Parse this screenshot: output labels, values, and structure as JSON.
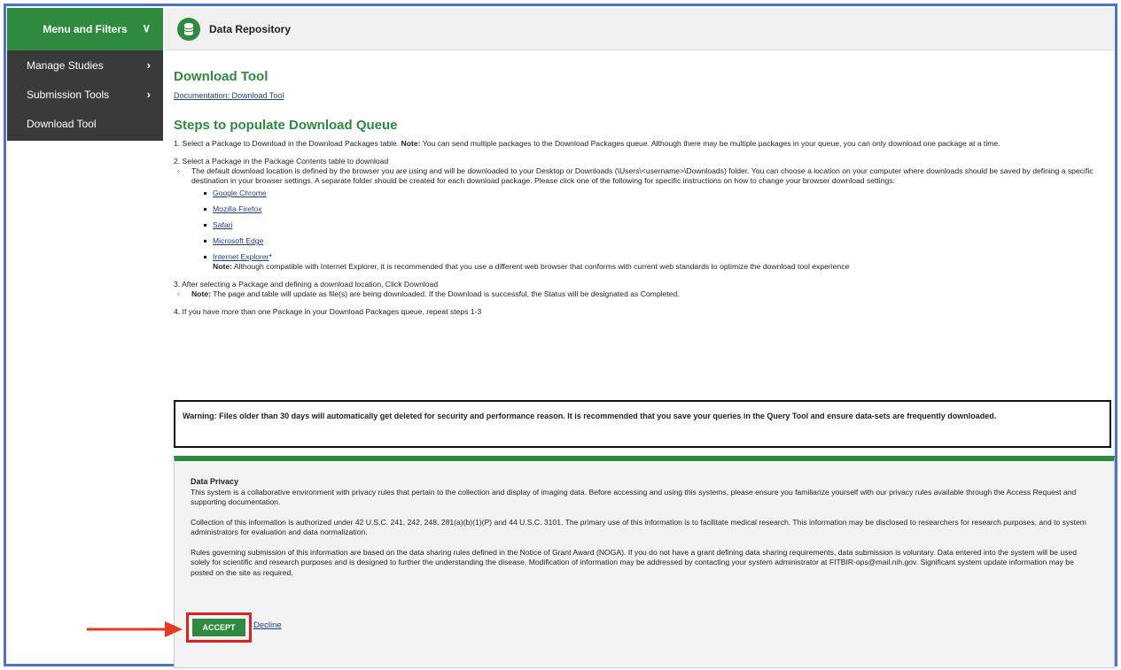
{
  "sidebar": {
    "header": "Menu and Filters",
    "items": [
      {
        "label": "Manage Studies"
      },
      {
        "label": "Submission Tools"
      },
      {
        "label": "Download Tool"
      }
    ]
  },
  "topbar": {
    "title": "Data Repository",
    "icon": "database-icon"
  },
  "main": {
    "title": "Download Tool",
    "doc_link": "Documentation: Download Tool",
    "steps_title": "Steps to populate Download Queue",
    "step1_a": "1. Select a Package to Download in the Download Packages table. ",
    "step1_note": "Note:",
    "step1_b": " You can send multiple packages to the Download Packages queue. Although there may be multiple packages in your queue, you can only download one package at a time.",
    "step2": "2. Select a Package in the Package Contents table to download",
    "step2_sub": "The default download location is defined by the browser you are using and will be downloaded to your Desktop or Downloads (\\Users\\<username>\\Downloads) folder. You can choose a location on your computer where downloads should be saved by defining a specific destination in your browser settings. A separate folder should be created for each download package. Please click one of the following for specific instructions on how to change your browser download settings:",
    "browsers": [
      "Google Chrome",
      "Mozilla Firefox",
      "Safari",
      "Microsoft Edge",
      "Internet Explorer"
    ],
    "ie_asterisk": "*",
    "ie_note_label": "Note:",
    "ie_note": " Although compatible with Internet Explorer, it is recommended that you use a different web browser that conforms with current web standards to optimize the download tool experience",
    "step3": "3. After selecting a Package and defining a download location, Click Download",
    "step3_note_label": "Note:",
    "step3_note": " The page and table will update as file(s) are being downloaded. If the Download is successful, the Status will be designated as Completed.",
    "step4": "4. If you have more than one Package in your Download Packages queue, repeat steps 1-3"
  },
  "warning": "Warning: Files older than 30 days will automatically get deleted for security and performance reason. It is recommended that you save your queries in the Query Tool and ensure data-sets are frequently downloaded.",
  "privacy": {
    "title": "Data Privacy",
    "p1": "This system is a collaborative environment with privacy rules that pertain to the collection and display of imaging data. Before accessing and using this systems, please ensure you familiarize yourself with our privacy rules available through the Access Request and supporting documentation.",
    "p2": "Collection of this information is authorized under 42 U.S.C. 241, 242, 248, 281(a)(b)(1)(P) and 44 U.S.C. 3101. The primary use of this information is to facilitate medical research. This information may be disclosed to researchers for research purposes, and to system administrators for evaluation and data normalization.",
    "p3": "Rules governing submission of this information are based on the data sharing rules defined in the Notice of Grant Award (NOGA). If you do not have a grant defining data sharing requirements, data submission is voluntary. Data entered into the system will be used solely for scientific and research purposes and is designed to further the understanding the disease. Modification of information may be addressed by contacting your system administrator at FITBIR-ops@mail.nih.gov. Significant system update information may be posted on the site as required.",
    "accept": "ACCEPT",
    "decline": "Decline"
  },
  "colors": {
    "brand_green": "#2e8b3e",
    "sidebar_bg": "#3a3a3a",
    "highlight_red": "#e02020",
    "frame_blue": "#4a73c9"
  }
}
